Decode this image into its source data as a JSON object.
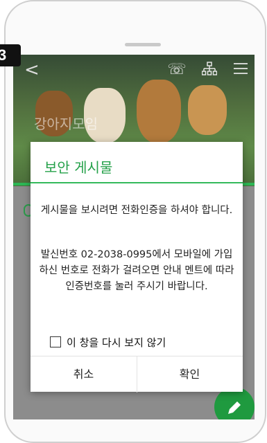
{
  "step_badge": "3",
  "toolbar": {
    "back_icon": "<",
    "call_icon": "☏",
    "tree_icon": "⚲",
    "menu_icon": "☰"
  },
  "cafe": {
    "title": "강아지모임"
  },
  "dialog": {
    "title": "보안 게시물",
    "message1": "게시물을 보시려면 전화인증을 하셔야 합니다.",
    "message2": "발신번호 02-2038-0995에서 모바일에 가입하신 번호로 전화가 걸려오면 안내 멘트에 따라 인증번호를 눌러 주시기 바랍니다.",
    "checkbox_label": "이 창을 다시 보지 않기",
    "cancel_label": "취소",
    "confirm_label": "확인"
  },
  "colors": {
    "accent": "#2cb755",
    "fab": "#1f9a3f"
  }
}
